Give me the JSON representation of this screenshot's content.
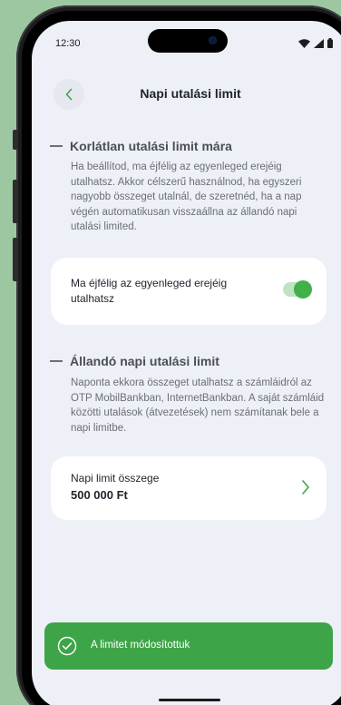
{
  "status_bar": {
    "time": "12:30",
    "icons": [
      "wifi-icon",
      "cellular-signal-icon",
      "battery-icon"
    ]
  },
  "header": {
    "back_icon": "chevron-left-icon",
    "title": "Napi utalási limit"
  },
  "section_unlimited": {
    "title": "Korlátlan utalási limit mára",
    "description": "Ha beállítod, ma éjfélig az egyenleged erejéig utalhatsz. Akkor célszerű használnod, ha egyszeri nagyobb összeget utalnál, de szeretnéd, ha a nap végén automatikusan visszaállna az állandó napi utalási limited.",
    "toggle_label": "Ma éjfélig az egyenleged erejéig utalhatsz",
    "toggle_on": true
  },
  "section_permanent": {
    "title": "Állandó napi utalási limit",
    "description": "Naponta ekkora összeget utalhatsz a számláidról az OTP MobilBankban, InternetBankban. A saját számláid közötti utalások (átvezetések) nem számítanak bele a napi limitbe.",
    "limit_label": "Napi limit összege",
    "limit_value": "500 000 Ft"
  },
  "toast": {
    "icon": "check-circle-icon",
    "message": "A limitet módosítottuk"
  },
  "colors": {
    "accent_green": "#3da548",
    "toggle_knob": "#41b04a",
    "background": "#eef0f7",
    "card": "#ffffff"
  }
}
